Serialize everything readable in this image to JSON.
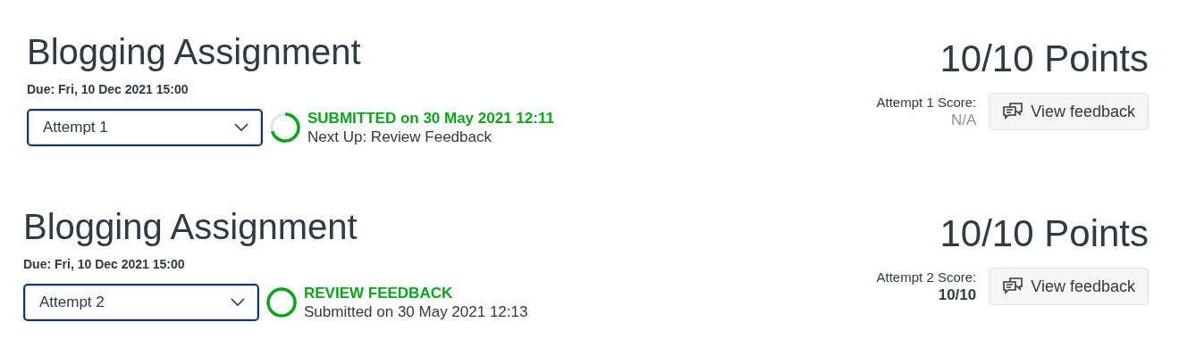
{
  "assignments": [
    {
      "title": "Blogging Assignment",
      "due": "Due: Fri, 10 Dec 2021 15:00",
      "points_value": "10/10",
      "points_label": "Points",
      "attempt": "Attempt 1",
      "progress": {
        "complete": false,
        "status": "SUBMITTED on 30 May 2021 12:11",
        "detail": "Next Up: Review Feedback"
      },
      "score_label": "Attempt 1 Score:",
      "score": "N/A",
      "graded": false,
      "button": "View feedback"
    },
    {
      "title": "Blogging Assignment",
      "due": "Due: Fri, 10 Dec 2021 15:00",
      "points_value": "10/10",
      "points_label": "Points",
      "attempt": "Attempt 2",
      "progress": {
        "complete": true,
        "status": "REVIEW FEEDBACK",
        "detail": "Submitted on 30 May 2021 12:13"
      },
      "score_label": "Attempt 2 Score:",
      "score": "10/10",
      "graded": true,
      "button": "View feedback"
    }
  ]
}
